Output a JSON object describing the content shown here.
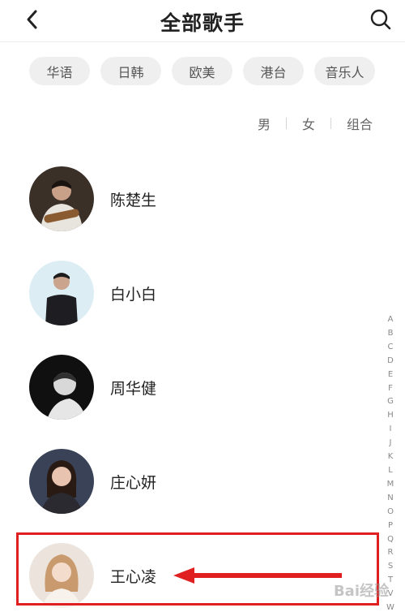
{
  "header": {
    "title": "全部歌手",
    "back_icon": "chevron-left-icon",
    "search_icon": "search-icon"
  },
  "filters": {
    "regions": [
      "华语",
      "日韩",
      "欧美",
      "港台",
      "音乐人"
    ],
    "genders": [
      "男",
      "女",
      "组合"
    ]
  },
  "artists": [
    {
      "name": "陈楚生"
    },
    {
      "name": "白小白"
    },
    {
      "name": "周华健"
    },
    {
      "name": "庄心妍"
    },
    {
      "name": "王心凌"
    }
  ],
  "alphabet_index": [
    "A",
    "B",
    "C",
    "D",
    "E",
    "F",
    "G",
    "H",
    "I",
    "J",
    "K",
    "L",
    "M",
    "N",
    "O",
    "P",
    "Q",
    "R",
    "S",
    "T",
    "V",
    "W"
  ],
  "annotation": {
    "highlight_color": "#e02020"
  },
  "watermark": "Bai经验"
}
